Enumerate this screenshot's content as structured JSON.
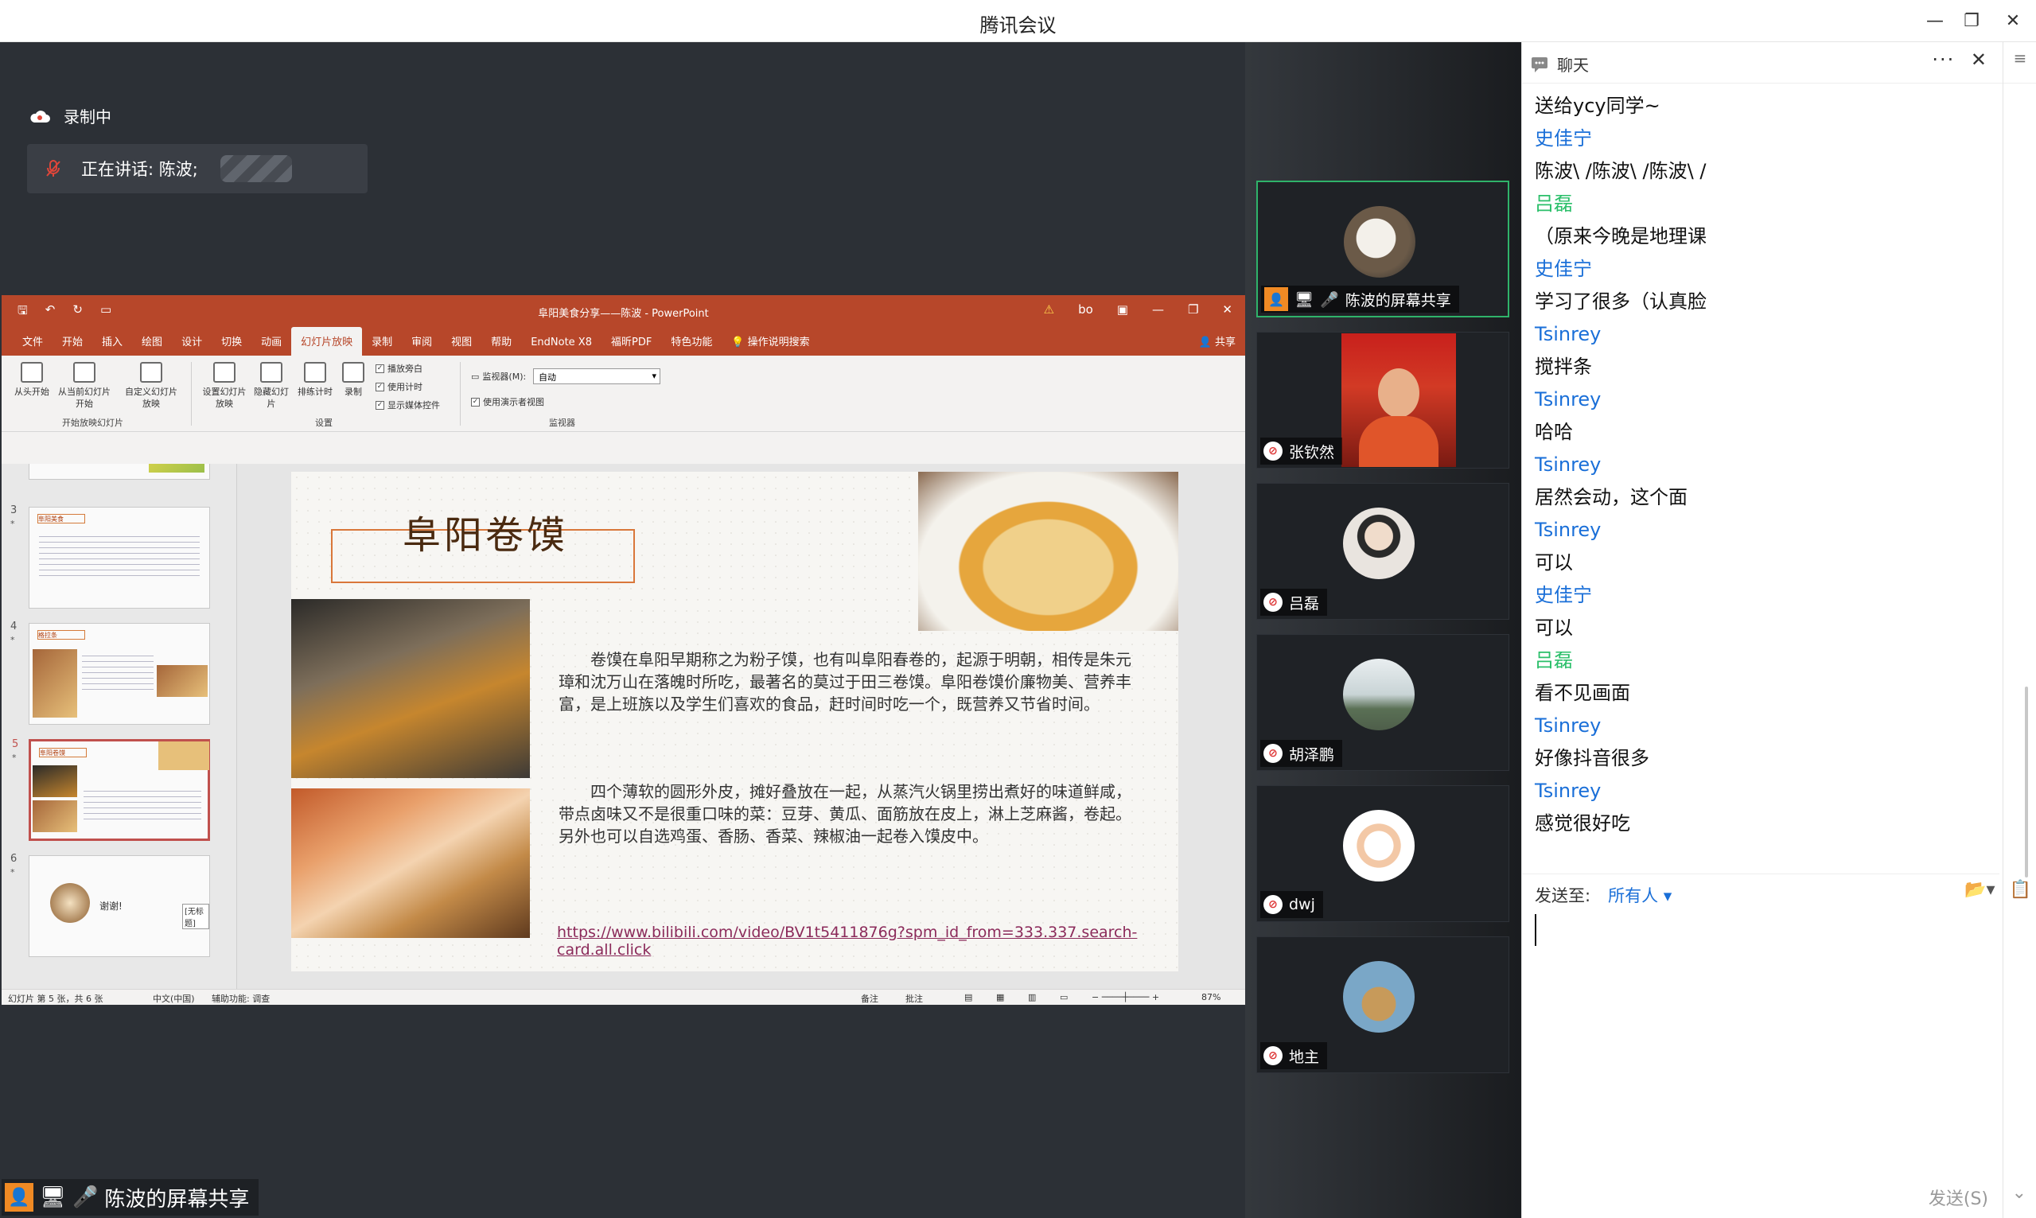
{
  "window": {
    "title": "腾讯会议",
    "minimize": "—",
    "restore": "❐",
    "close": "✕"
  },
  "stage": {
    "recording": "录制中",
    "speaking": "正在讲话: 陈波;"
  },
  "ppt": {
    "doc_title": "阜阳美食分享——陈波 - PowerPoint",
    "user": "bo",
    "share": "共享",
    "tabs": [
      "文件",
      "开始",
      "插入",
      "绘图",
      "设计",
      "切换",
      "动画",
      "幻灯片放映",
      "录制",
      "审阅",
      "视图",
      "帮助",
      "EndNote X8",
      "福昕PDF",
      "特色功能"
    ],
    "active_tab": "幻灯片放映",
    "tell_me": "操作说明搜索",
    "ribbon": {
      "from_start": "从头开始",
      "from_current": "从当前幻灯片开始",
      "custom": "自定义幻灯片放映",
      "setup": "设置幻灯片放映",
      "hide": "隐藏幻灯片",
      "rehearse": "排练计时",
      "record": "录制",
      "chk_narration": "播放旁白",
      "chk_timing": "使用计时",
      "chk_media": "显示媒体控件",
      "monitor_label": "监视器(M):",
      "monitor_value": "自动",
      "chk_presenter": "使用演示者视图",
      "group_start": "开始放映幻灯片",
      "group_setup": "设置",
      "group_monitor": "监视器"
    },
    "thumbs": [
      {
        "num": "3",
        "header": "阜阳美食"
      },
      {
        "num": "4",
        "header": "格拉条"
      },
      {
        "num": "5",
        "header": "阜阳卷馍"
      },
      {
        "num": "6",
        "thanks": "谢谢!",
        "note": "[无标题]"
      }
    ],
    "slide": {
      "title": "阜阳卷馍",
      "para1": "卷馍在阜阳早期称之为粉子馍，也有叫阜阳春卷的，起源于明朝，相传是朱元璋和沈万山在落魄时所吃，最著名的莫过于田三卷馍。阜阳卷馍价廉物美、营养丰富，是上班族以及学生们喜欢的食品，赶时间时吃一个，既营养又节省时间。",
      "para2": "四个薄软的圆形外皮，摊好叠放在一起，从蒸汽火锅里捞出煮好的味道鲜咸，带点卤味又不是很重口味的菜：豆芽、黄瓜、面筋放在皮上，淋上芝麻酱，卷起。另外也可以自选鸡蛋、香肠、香菜、辣椒油一起卷入馍皮中。",
      "link": "https://www.bilibili.com/video/BV1t5411876g?spm_id_from=333.337.search-card.all.click"
    },
    "status": {
      "slide_pos": "幻灯片 第 5 张，共 6 张",
      "lang": "中文(中国)",
      "access": "辅助功能: 调查",
      "notes": "备注",
      "comments": "批注",
      "zoom": "87%"
    }
  },
  "sharebar": {
    "label": "陈波的屏幕共享"
  },
  "participants": [
    {
      "name": "陈波的屏幕共享",
      "active": true
    },
    {
      "name": "张钦然"
    },
    {
      "name": "吕磊"
    },
    {
      "name": "胡泽鹏"
    },
    {
      "name": "dwj"
    },
    {
      "name": "地主"
    }
  ],
  "chat": {
    "title": "聊天",
    "messages": [
      {
        "type": "text",
        "text": "送给ycy同学~"
      },
      {
        "type": "sender",
        "text": "史佳宁",
        "color": "blue"
      },
      {
        "type": "text",
        "text": "陈波\\ /陈波\\ /陈波\\ /"
      },
      {
        "type": "sender",
        "text": "吕磊",
        "color": "green"
      },
      {
        "type": "text",
        "text": "（原来今晚是地理课"
      },
      {
        "type": "sender",
        "text": "史佳宁",
        "color": "blue"
      },
      {
        "type": "text",
        "text": "学习了很多（认真脸"
      },
      {
        "type": "sender",
        "text": "Tsinrey",
        "color": "blue"
      },
      {
        "type": "text",
        "text": "搅拌条"
      },
      {
        "type": "sender",
        "text": "Tsinrey",
        "color": "blue"
      },
      {
        "type": "text",
        "text": "哈哈"
      },
      {
        "type": "sender",
        "text": "Tsinrey",
        "color": "blue"
      },
      {
        "type": "text",
        "text": "居然会动，这个面"
      },
      {
        "type": "sender",
        "text": "Tsinrey",
        "color": "blue"
      },
      {
        "type": "text",
        "text": "可以"
      },
      {
        "type": "sender",
        "text": "史佳宁",
        "color": "blue"
      },
      {
        "type": "text",
        "text": "可以"
      },
      {
        "type": "sender",
        "text": "吕磊",
        "color": "green"
      },
      {
        "type": "text",
        "text": "看不见画面"
      },
      {
        "type": "sender",
        "text": "Tsinrey",
        "color": "blue"
      },
      {
        "type": "text",
        "text": "好像抖音很多"
      },
      {
        "type": "sender",
        "text": "Tsinrey",
        "color": "blue"
      },
      {
        "type": "text",
        "text": "感觉很好吃"
      }
    ],
    "send_to_label": "发送至:",
    "send_to_value": "所有人",
    "send_button": "发送(S)"
  }
}
